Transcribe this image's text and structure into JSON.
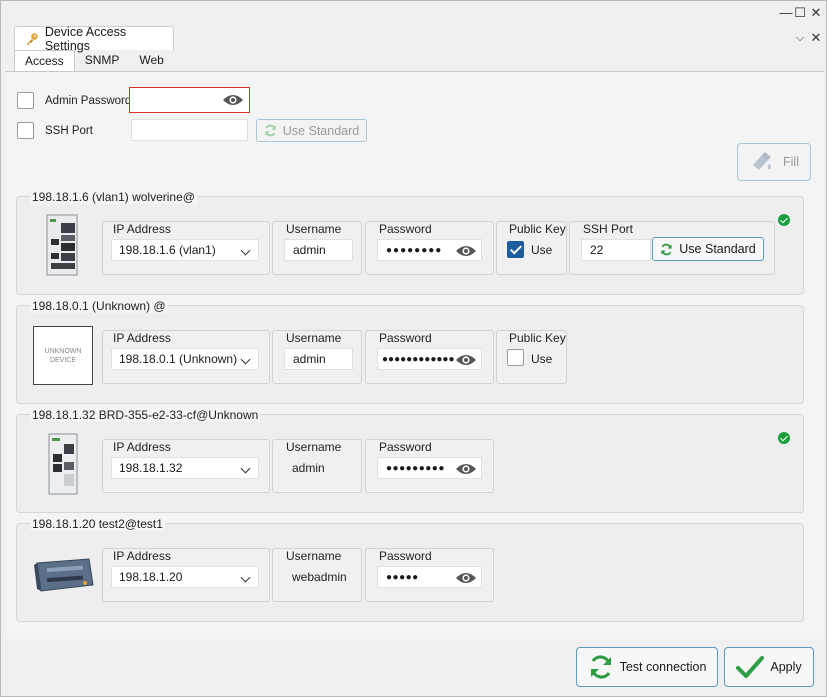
{
  "window": {
    "tab_title": "Device Access Settings"
  },
  "subtabs": [
    "Access",
    "SNMP",
    "Web"
  ],
  "global": {
    "admin_password_label": "Admin Password",
    "admin_password_value": "",
    "ssh_port_label": "SSH Port",
    "ssh_port_value": "",
    "use_standard_label": "Use Standard",
    "fill_label": "Fill"
  },
  "labels": {
    "ip_address": "IP Address",
    "username": "Username",
    "password": "Password",
    "public_key": "Public Key",
    "ssh_port": "SSH Port",
    "use": "Use",
    "use_standard": "Use Standard"
  },
  "devices": [
    {
      "title": "198.18.1.6 (vlan1) wolverine@",
      "ip": "198.18.1.6 (vlan1)",
      "username": "admin",
      "password_mask": "●●●●●●●●",
      "public_key_use": true,
      "ssh_port": "22",
      "status": "ok"
    },
    {
      "title": "198.18.0.1 (Unknown) @",
      "ip": "198.18.0.1 (Unknown)",
      "username": "admin",
      "password_mask": "●●●●●●●●●●●●",
      "public_key_use": false,
      "device_placeholder": [
        "UNKNOWN",
        "DEVICE"
      ]
    },
    {
      "title": "198.18.1.32 BRD-355-e2-33-cf@Unknown",
      "ip": "198.18.1.32",
      "username": "admin",
      "password_mask": "●●●●●●●●●",
      "status": "ok"
    },
    {
      "title": "198.18.1.20 test2@test1",
      "ip": "198.18.1.20",
      "username": "webadmin",
      "password_mask": "●●●●●"
    }
  ],
  "footer": {
    "test_connection": "Test connection",
    "apply": "Apply"
  },
  "colors": {
    "accent": "#1f5c9e",
    "ok": "#1a9f3c",
    "invalid_border": "#d9302c",
    "button_border": "#5e9ac0"
  }
}
